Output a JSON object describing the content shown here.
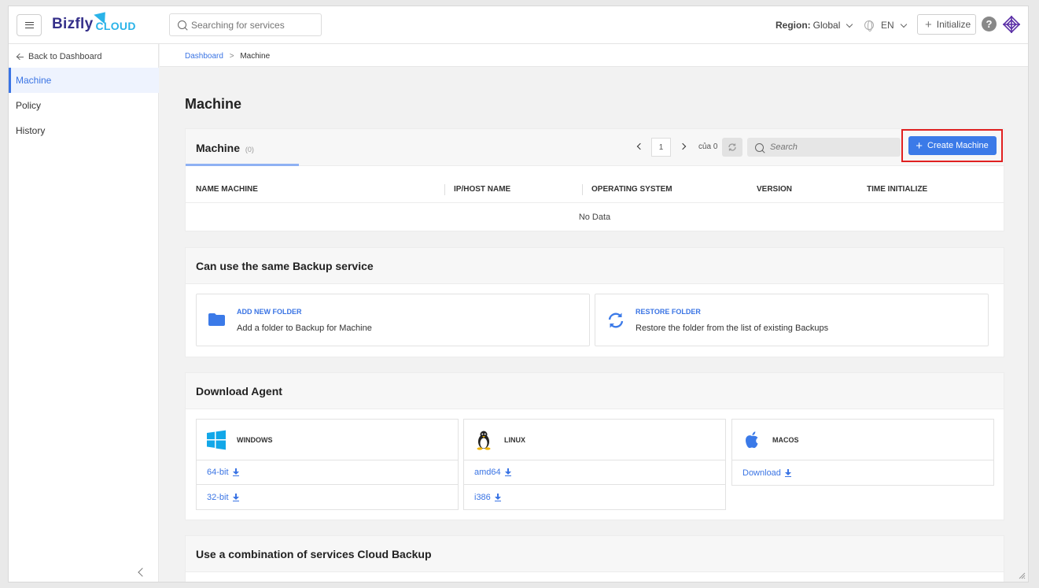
{
  "header": {
    "logo_main": "Bizfly",
    "logo_sub": "CLOUD",
    "search_placeholder": "Searching for services",
    "region_label": "Region:",
    "region_value": "Global",
    "language": "EN",
    "initialize_label": "Initialize",
    "help_symbol": "?"
  },
  "sidebar": {
    "back_label": "Back to Dashboard",
    "items": [
      {
        "label": "Machine",
        "active": true
      },
      {
        "label": "Policy",
        "active": false
      },
      {
        "label": "History",
        "active": false
      }
    ]
  },
  "breadcrumb": {
    "root": "Dashboard",
    "separator": ">",
    "current": "Machine"
  },
  "page": {
    "title": "Machine"
  },
  "machine_table": {
    "title": "Machine",
    "count": "(0)",
    "page": "1",
    "of_label": "của 0",
    "search_placeholder": "Search",
    "create_label": "Create Machine",
    "columns": [
      "NAME MACHINE",
      "IP/HOST NAME",
      "OPERATING SYSTEM",
      "VERSION",
      "TIME INITIALIZE"
    ],
    "empty_text": "No Data"
  },
  "backup_service": {
    "title": "Can use the same Backup service",
    "options": [
      {
        "title": "ADD NEW FOLDER",
        "desc": "Add a folder to Backup for Machine",
        "icon": "folder-icon"
      },
      {
        "title": "RESTORE FOLDER",
        "desc": "Restore the folder from the list of existing Backups",
        "icon": "restore-icon"
      }
    ]
  },
  "download_agent": {
    "title": "Download Agent",
    "platforms": [
      {
        "name": "WINDOWS",
        "icon": "windows-icon",
        "links": [
          "64-bit",
          "32-bit"
        ]
      },
      {
        "name": "LINUX",
        "icon": "linux-icon",
        "links": [
          "amd64",
          "i386"
        ]
      },
      {
        "name": "MACOS",
        "icon": "apple-icon",
        "links": [
          "Download"
        ]
      }
    ]
  },
  "combination": {
    "title": "Use a combination of services Cloud Backup"
  },
  "colors": {
    "accent": "#3b7ae8",
    "highlight_border": "#e02020",
    "brand": "#35308a",
    "brand_secondary": "#2ab3e8"
  }
}
